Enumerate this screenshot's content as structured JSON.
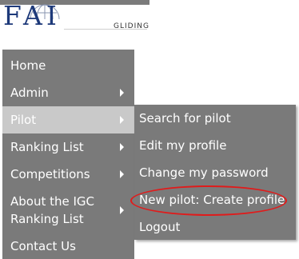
{
  "logo": {
    "text": "FAI",
    "subtitle": "GLIDING"
  },
  "menu": {
    "items": [
      {
        "label": "Home",
        "has_submenu": false
      },
      {
        "label": "Admin",
        "has_submenu": true
      },
      {
        "label": "Pilot",
        "has_submenu": true,
        "active": true
      },
      {
        "label": "Ranking List",
        "has_submenu": true
      },
      {
        "label": "Competitions",
        "has_submenu": true
      },
      {
        "label": "About the IGC Ranking List",
        "has_submenu": true
      },
      {
        "label": "Contact Us",
        "has_submenu": false
      }
    ]
  },
  "submenu": {
    "items": [
      {
        "label": "Search for pilot"
      },
      {
        "label": "Edit my profile"
      },
      {
        "label": "Change my password"
      },
      {
        "label": "New pilot: Create profile",
        "highlighted": true
      },
      {
        "label": "Logout"
      }
    ]
  },
  "colors": {
    "menu_bg": "#7a7a7a",
    "active_bg": "#c9c9c9",
    "logo_blue": "#1e3a7a",
    "highlight_red": "#e01b1b"
  }
}
